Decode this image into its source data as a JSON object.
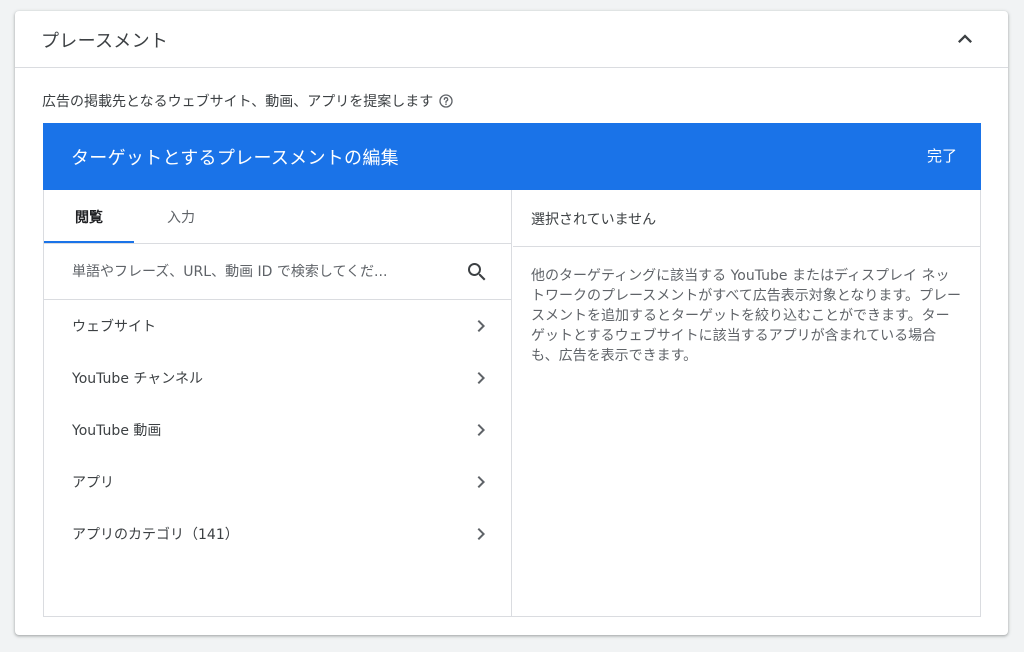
{
  "card": {
    "title": "プレースメント",
    "subtitle": "広告の掲載先となるウェブサイト、動画、アプリを提案します"
  },
  "editor": {
    "title": "ターゲットとするプレースメントの編集",
    "done_label": "完了"
  },
  "tabs": {
    "browse": "閲覧",
    "input": "入力"
  },
  "search": {
    "placeholder": "単語やフレーズ、URL、動画 ID で検索してくだ..."
  },
  "nav_items": [
    {
      "label": "ウェブサイト"
    },
    {
      "label": "YouTube チャンネル"
    },
    {
      "label": "YouTube 動画"
    },
    {
      "label": "アプリ"
    },
    {
      "label": "アプリのカテゴリ（141）"
    }
  ],
  "selection": {
    "header": "選択されていません",
    "description": "他のターゲティングに該当する YouTube またはディスプレイ ネットワークのプレースメントがすべて広告表示対象となります。プレースメントを追加するとターゲットを絞り込むことができます。ターゲットとするウェブサイトに該当するアプリが含まれている場合も、広告を表示できます。"
  },
  "colors": {
    "accent": "#1a73e8",
    "text": "#3c4043",
    "border": "#dadce0"
  }
}
